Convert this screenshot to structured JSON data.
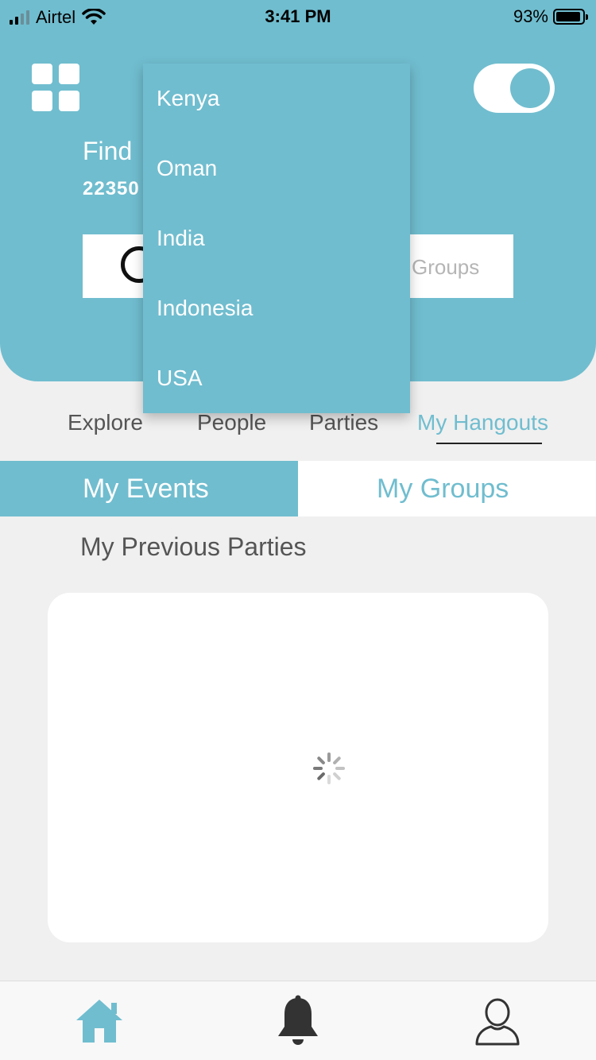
{
  "status_bar": {
    "carrier": "Airtel",
    "time": "3:41 PM",
    "battery_percent": "93%",
    "battery_level": 0.93,
    "signal_bars": 2
  },
  "header": {
    "menu_icon": "grid-icon",
    "title_visible": "Find",
    "count_visible": "22350",
    "toggle_on": true
  },
  "segments": {
    "right_label": "Groups"
  },
  "dropdown": {
    "options": [
      "Kenya",
      "Oman",
      "India",
      "Indonesia",
      "USA"
    ]
  },
  "tabs": [
    {
      "label": "Explore"
    },
    {
      "label": "People"
    },
    {
      "label": "Parties"
    },
    {
      "label": "My Hangouts",
      "active": true
    }
  ],
  "subtabs": {
    "events": "My Events",
    "groups": "My Groups"
  },
  "section": {
    "title": "My Previous Parties"
  },
  "bottom_nav": [
    {
      "icon": "home-icon",
      "active": true
    },
    {
      "icon": "bell-icon"
    },
    {
      "icon": "profile-icon"
    }
  ],
  "colors": {
    "accent": "#70bdcf",
    "background": "#f0f0f0"
  }
}
